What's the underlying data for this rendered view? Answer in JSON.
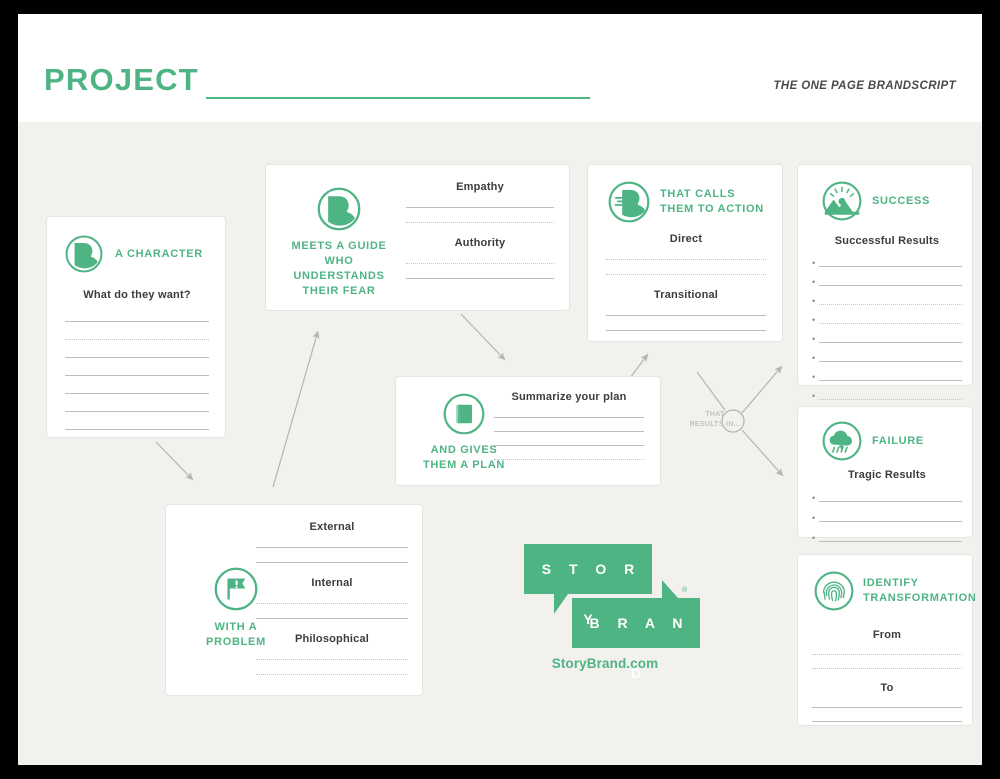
{
  "header": {
    "title": "PROJECT",
    "subtitle": "THE ONE PAGE BRANDSCRIPT"
  },
  "colors": {
    "brand_green": "#4FB484",
    "page_background": "#F2F1ED",
    "card_background": "#FFFFFF",
    "text_dark": "#3C3C3C",
    "line_gray": "#BEBEBE",
    "arrow_gray": "#B5B4B0"
  },
  "cards": {
    "character": {
      "title": "A CHARACTER",
      "icon": "head-profile-icon",
      "field_label": "What do they want?",
      "line_count": 7
    },
    "guide": {
      "title": "MEETS A GUIDE WHO UNDERSTANDS THEIR FEAR",
      "title_lines": [
        "MEETS A GUIDE",
        "WHO UNDERSTANDS",
        "THEIR FEAR"
      ],
      "icon": "head-profile-icon",
      "fields": [
        {
          "label": "Empathy",
          "line_count": 2
        },
        {
          "label": "Authority",
          "line_count": 2
        }
      ]
    },
    "call_to_action": {
      "title": "THAT CALLS THEM TO ACTION",
      "title_lines": [
        "THAT CALLS",
        "THEM TO ACTION"
      ],
      "icon": "speaking-head-icon",
      "fields": [
        {
          "label": "Direct",
          "line_count": 2
        },
        {
          "label": "Transitional",
          "line_count": 2
        }
      ]
    },
    "success": {
      "title": "SUCCESS",
      "icon": "mountain-sunrise-icon",
      "field_label": "Successful Results",
      "bullet_count": 8
    },
    "failure": {
      "title": "FAILURE",
      "icon": "rain-cloud-icon",
      "field_label": "Tragic Results",
      "bullet_count": 3
    },
    "transformation": {
      "title": "IDENTIFY TRANSFORMATION",
      "title_lines": [
        "IDENTIFY",
        "TRANSFORMATION"
      ],
      "icon": "fingerprint-icon",
      "fields": [
        {
          "label": "From",
          "line_count": 2
        },
        {
          "label": "To",
          "line_count": 2
        }
      ]
    },
    "problem": {
      "title": "WITH A PROBLEM",
      "title_lines": [
        "WITH A",
        "PROBLEM"
      ],
      "icon": "flag-exclamation-icon",
      "fields": [
        {
          "label": "External",
          "line_count": 2
        },
        {
          "label": "Internal",
          "line_count": 2
        },
        {
          "label": "Philosophical",
          "line_count": 2
        }
      ]
    },
    "plan": {
      "title": "AND GIVES THEM A PLAN",
      "title_lines": [
        "AND GIVES",
        "THEM A PLAN"
      ],
      "icon": "book-icon",
      "field_label": "Summarize your plan",
      "line_count": 4
    }
  },
  "connectors": {
    "junction_label_lines": [
      "THAT",
      "RESULTS IN..."
    ],
    "junction_label": "THAT RESULTS IN..."
  },
  "logo": {
    "word_top": "S T O R Y",
    "word_bottom": "B R A N D",
    "registered_mark": "®",
    "url": "StoryBrand.com"
  }
}
